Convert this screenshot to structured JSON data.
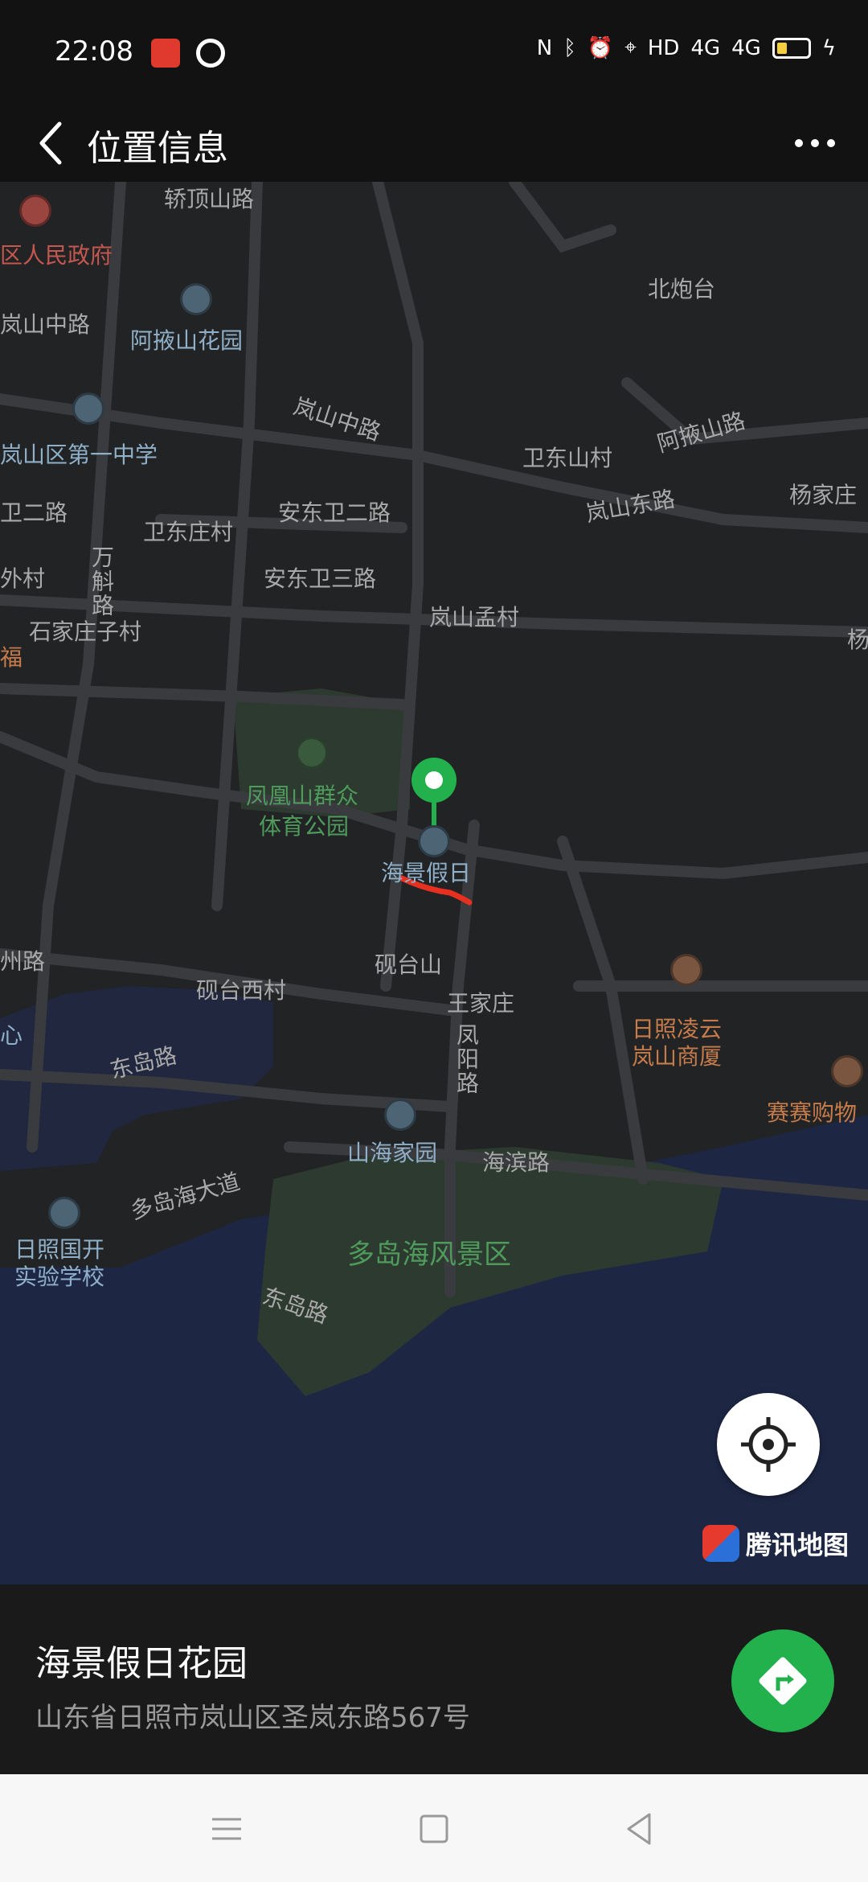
{
  "status_bar": {
    "time": "22:08",
    "indicators": "HD",
    "signal_1": "4G",
    "signal_2": "4G"
  },
  "header": {
    "title": "位置信息",
    "back_icon": "chevron-left-icon",
    "more_icon": "more-horizontal-icon"
  },
  "map": {
    "labels": {
      "jiaoding_road": "轿顶山路",
      "district_gov": "区人民政府",
      "lanshan_zhong_road_w": "岚山中路",
      "abashan_garden": "阿掖山花园",
      "beipaotai": "北炮台",
      "lanshan_zhong_road": "岚山中路",
      "lanshan_no1_middle": "岚山区第一中学",
      "aba_mountain_road": "阿掖山路",
      "weidong_mountain_village": "卫东山村",
      "yangjiazhuang": "杨家庄",
      "weier_road_w": "卫二路",
      "weidong_village": "卫东庄村",
      "andong_wei2_road": "安东卫二路",
      "lanshan_east_road": "岚山东路",
      "wanhu_road": "万斛路",
      "wai_village": "外村",
      "andong_wei3_road": "安东卫三路",
      "lanshan_meng_village": "岚山孟村",
      "shijiazhuangzi": "石家庄子村",
      "fu": "福",
      "yang": "杨",
      "fenghuang_park_1": "凤凰山群众",
      "fenghuang_park_2": "体育公园",
      "haijing_short": "海景假日",
      "zhou_road": "州路",
      "yantaishan": "砚台山",
      "yantai_west_village": "砚台西村",
      "wangjiazhuang": "王家庄",
      "rizhao_lingyun_1": "日照凌云",
      "rizhao_lingyun_2": "岚山商厦",
      "fengyang_road": "凤阳路",
      "dongdao_road": "东岛路",
      "saisai_mall": "赛赛购物",
      "shanhai_garden": "山海家园",
      "haibin_road": "海滨路",
      "duodao_avenue": "多岛海大道",
      "rizhao_school_1": "日照国开",
      "rizhao_school_2": "实验学校",
      "duodao_scenic": "多岛海风景区",
      "dongdao_road_2": "东岛路",
      "xin": "心"
    },
    "logo_text": "腾讯地图",
    "locate_icon": "crosshair-icon",
    "pin_icon": "location-pin-icon"
  },
  "place": {
    "name": "海景假日花园",
    "address": "山东省日照市岚山区圣岚东路567号",
    "nav_icon": "navigation-arrow-icon"
  },
  "colors": {
    "map_bg": "#222325",
    "road": "#3a3b3e",
    "green_area": "#2d3a2f",
    "water": "#1d2744",
    "pin": "#22b14c",
    "nav_button": "#22b14c",
    "underline": "#e83020"
  },
  "system_nav": {
    "menu_icon": "menu-icon",
    "home_icon": "square-icon",
    "back_icon": "triangle-back-icon"
  }
}
